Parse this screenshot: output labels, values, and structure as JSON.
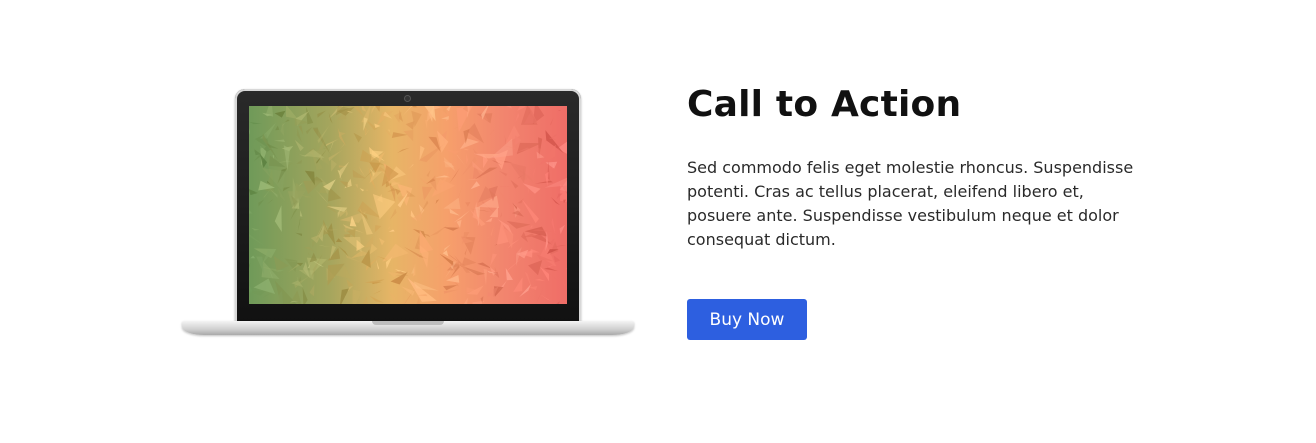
{
  "cta": {
    "title": "Call to Action",
    "description": "Sed commodo felis eget molestie rhoncus. Suspendisse potenti. Cras ac tellus placerat, eleifend libero et, posuere ante. Suspendisse vestibulum neque et dolor consequat dictum.",
    "button_label": "Buy Now"
  },
  "colors": {
    "button": "#2d5fe0",
    "title": "#111111",
    "text": "#2a2a2a",
    "background": "#ffffff"
  },
  "image": {
    "icon": "laptop-illustration"
  }
}
